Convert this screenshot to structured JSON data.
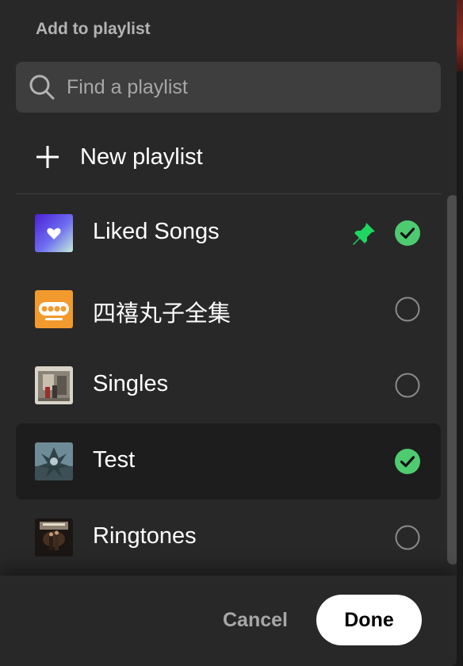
{
  "dialog": {
    "title": "Add to playlist"
  },
  "search": {
    "placeholder": "Find a playlist",
    "value": "",
    "icon": "search-icon"
  },
  "new_playlist": {
    "label": "New playlist",
    "icon": "plus-icon"
  },
  "playlists": [
    {
      "name": "Liked Songs",
      "checked": true,
      "pinned": true,
      "cover": "heart-cover"
    },
    {
      "name": "四禧丸子全集",
      "checked": false,
      "pinned": false,
      "cover": "logo-cover"
    },
    {
      "name": "Singles",
      "checked": false,
      "pinned": false,
      "cover": "photo-cover"
    },
    {
      "name": "Test",
      "checked": true,
      "pinned": false,
      "cover": "photo-cover"
    },
    {
      "name": "Ringtones",
      "checked": false,
      "pinned": false,
      "cover": "photo-cover"
    }
  ],
  "footer": {
    "cancel_label": "Cancel",
    "done_label": "Done"
  },
  "colors": {
    "panel": "#282828",
    "accent_green": "#1ed760",
    "check_green": "#4ecb71",
    "text_primary": "#ffffff",
    "text_secondary": "#a7a7a7"
  }
}
